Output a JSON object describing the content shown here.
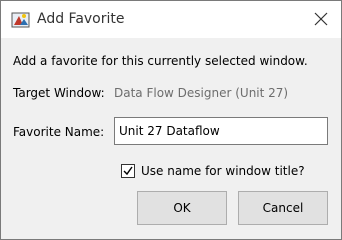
{
  "window": {
    "title": "Add Favorite",
    "app_icon": "app-favorite-icon",
    "close_icon": "close-icon"
  },
  "description": "Add a favorite for this currently selected window.",
  "target": {
    "label": "Target Window:",
    "value": "Data Flow Designer (Unit 27)"
  },
  "favorite_name": {
    "label": "Favorite Name:",
    "value": "Unit 27 Dataflow"
  },
  "use_name_checkbox": {
    "label": "Use name for window title?",
    "checked": true
  },
  "buttons": {
    "ok": "OK",
    "cancel": "Cancel"
  }
}
